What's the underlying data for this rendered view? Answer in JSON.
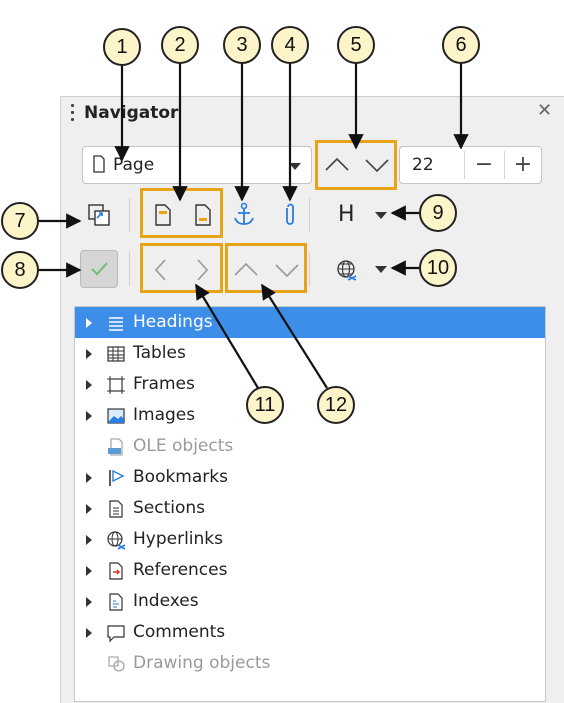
{
  "panel": {
    "title": "Navigator",
    "close_icon": "close-icon"
  },
  "navigate_by": {
    "selected": "Page"
  },
  "page_number": {
    "value": "22",
    "minus": "−",
    "plus": "+"
  },
  "heading_level_label": "H",
  "tree": {
    "items": [
      {
        "label": "Headings",
        "icon": "headings-icon",
        "selected": true,
        "enabled": true,
        "expandable": true
      },
      {
        "label": "Tables",
        "icon": "tables-icon",
        "selected": false,
        "enabled": true,
        "expandable": true
      },
      {
        "label": "Frames",
        "icon": "frames-icon",
        "selected": false,
        "enabled": true,
        "expandable": true
      },
      {
        "label": "Images",
        "icon": "images-icon",
        "selected": false,
        "enabled": true,
        "expandable": true
      },
      {
        "label": "OLE objects",
        "icon": "ole-icon",
        "selected": false,
        "enabled": false,
        "expandable": false
      },
      {
        "label": "Bookmarks",
        "icon": "bookmark-icon",
        "selected": false,
        "enabled": true,
        "expandable": true
      },
      {
        "label": "Sections",
        "icon": "section-icon",
        "selected": false,
        "enabled": true,
        "expandable": true
      },
      {
        "label": "Hyperlinks",
        "icon": "hyperlink-icon",
        "selected": false,
        "enabled": true,
        "expandable": true
      },
      {
        "label": "References",
        "icon": "reference-icon",
        "selected": false,
        "enabled": true,
        "expandable": true
      },
      {
        "label": "Indexes",
        "icon": "index-icon",
        "selected": false,
        "enabled": true,
        "expandable": true
      },
      {
        "label": "Comments",
        "icon": "comment-icon",
        "selected": false,
        "enabled": true,
        "expandable": true
      },
      {
        "label": "Drawing objects",
        "icon": "drawing-icon",
        "selected": false,
        "enabled": false,
        "expandable": false
      }
    ]
  },
  "callouts": [
    "1",
    "2",
    "3",
    "4",
    "5",
    "6",
    "7",
    "8",
    "9",
    "10",
    "11",
    "12"
  ],
  "colors": {
    "highlight": "#e8a317",
    "selection": "#3d8ee8",
    "callout_fill": "#fdf5c9",
    "accent_blue": "#2a7de1"
  }
}
